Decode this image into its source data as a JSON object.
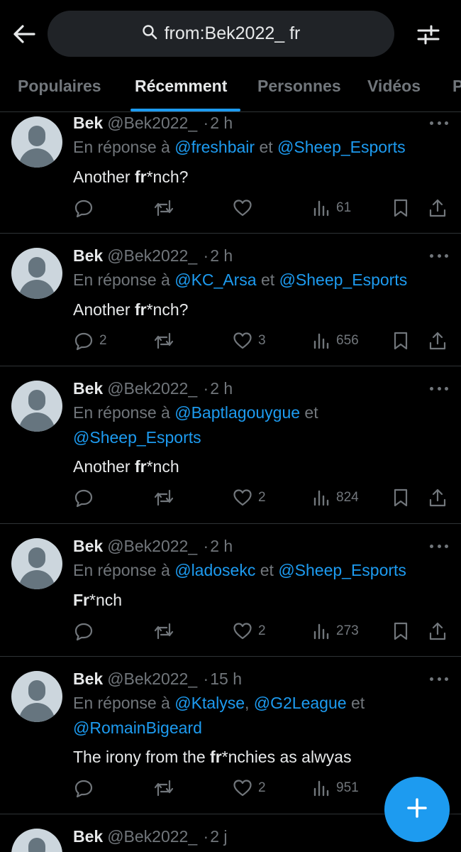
{
  "search": {
    "query": "from:Bek2022_ fr"
  },
  "tabs": [
    {
      "label": "Populaires"
    },
    {
      "label": "Récemment"
    },
    {
      "label": "Personnes"
    },
    {
      "label": "Vidéos"
    },
    {
      "label": "P"
    }
  ],
  "active_tab": "Récemment",
  "colors": {
    "accent": "#1d9bf0",
    "background": "#000000",
    "muted": "#71767b",
    "text": "#e7e9ea"
  },
  "icons": [
    "back-arrow-icon",
    "search-icon",
    "filter-icon",
    "more-icon",
    "reply-icon",
    "retweet-icon",
    "like-icon",
    "views-icon",
    "bookmark-icon",
    "share-icon",
    "plus-icon"
  ],
  "tweets": [
    {
      "name": "Bek",
      "handle": "@Bek2022_",
      "dot": "·",
      "time": "2 h",
      "reply_prefix": "En réponse à ",
      "reply_parts": [
        "@freshbair",
        " et ",
        "@Sheep_Esports"
      ],
      "text_before": "Another ",
      "text_bold": "fr",
      "text_after": "*nch?",
      "replies": "",
      "retweets": "",
      "likes": "",
      "views": "61"
    },
    {
      "name": "Bek",
      "handle": "@Bek2022_",
      "dot": "·",
      "time": "2 h",
      "reply_prefix": "En réponse à ",
      "reply_parts": [
        "@KC_Arsa",
        " et ",
        "@Sheep_Esports"
      ],
      "text_before": "Another ",
      "text_bold": "fr",
      "text_after": "*nch?",
      "replies": "2",
      "retweets": "",
      "likes": "3",
      "views": "656"
    },
    {
      "name": "Bek",
      "handle": "@Bek2022_",
      "dot": "·",
      "time": "2 h",
      "reply_prefix": "En réponse à ",
      "reply_parts": [
        "@Baptlagouygue",
        " et ",
        "@Sheep_Esports"
      ],
      "text_before": "Another ",
      "text_bold": "fr",
      "text_after": "*nch",
      "replies": "",
      "retweets": "",
      "likes": "2",
      "views": "824"
    },
    {
      "name": "Bek",
      "handle": "@Bek2022_",
      "dot": "·",
      "time": "2 h",
      "reply_prefix": "En réponse à ",
      "reply_parts": [
        "@ladosekc",
        " et ",
        "@Sheep_Esports"
      ],
      "text_before": "",
      "text_bold": "Fr",
      "text_after": "*nch",
      "replies": "",
      "retweets": "",
      "likes": "2",
      "views": "273"
    },
    {
      "name": "Bek",
      "handle": "@Bek2022_",
      "dot": "·",
      "time": "15 h",
      "reply_prefix": "En réponse à ",
      "reply_parts": [
        "@Ktalyse",
        ", ",
        "@G2League",
        " et ",
        "@RomainBigeard"
      ],
      "text_before": "The irony from the ",
      "text_bold": "fr",
      "text_after": "*nchies as alwyas",
      "replies": "",
      "retweets": "",
      "likes": "2",
      "views": "951"
    },
    {
      "name": "Bek",
      "handle": "@Bek2022_",
      "dot": "·",
      "time": "2 j"
    }
  ]
}
